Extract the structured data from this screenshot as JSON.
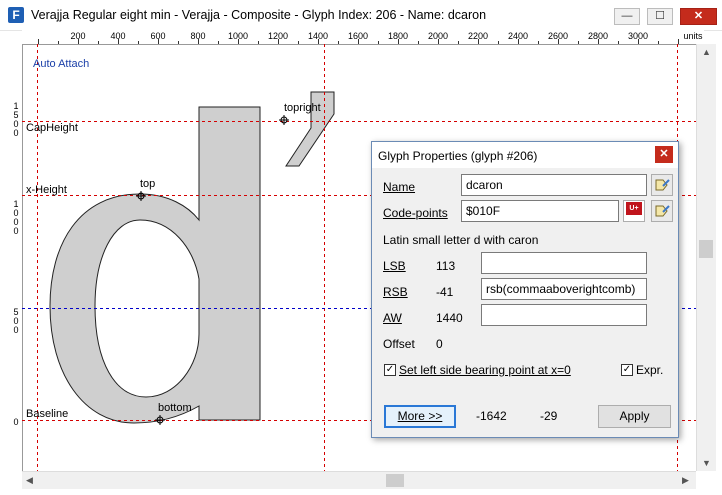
{
  "window": {
    "title": "Verajja Regular eight min - Verajja - Composite - Glyph Index: 206 - Name: dcaron",
    "app_icon": "F",
    "minimize": "—",
    "maximize": "☐",
    "close": "✕"
  },
  "ruler": {
    "top_ticks": [
      "200",
      "400",
      "600",
      "800",
      "1000",
      "1200",
      "1400",
      "1600",
      "1800",
      "2000",
      "2200",
      "2400",
      "2600",
      "2800",
      "3000"
    ],
    "units_label": "units",
    "left_labels": [
      [
        "1",
        "5",
        "0",
        "0"
      ],
      [
        "1",
        "0",
        "0",
        "0"
      ],
      [
        "5",
        "0",
        "0"
      ],
      [
        "0"
      ]
    ]
  },
  "canvas": {
    "auto_attach": "Auto Attach",
    "guides": {
      "cap_height": "CapHeight",
      "x_height": "x-Height",
      "baseline": "Baseline"
    },
    "points": {
      "top": "top",
      "topright": "topright",
      "bottom": "bottom"
    },
    "colors": {
      "red_guide": "#d40000",
      "blue_guide": "#0000c8",
      "glyph_fill": "#cfcfcf",
      "auto_attach": "#1a3fa8"
    }
  },
  "dialog": {
    "title": "Glyph Properties (glyph #206)",
    "close": "✕",
    "name_label": "Name",
    "name_value": "dcaron",
    "codepoints_label": "Code-points",
    "codepoints_value": "$010F",
    "description": "Latin small letter d with caron",
    "lsb_label": "LSB",
    "lsb_value": "113",
    "lsb_expr": "",
    "rsb_label": "RSB",
    "rsb_value": "-41",
    "rsb_expr": "rsb(commaaboverightcomb)",
    "aw_label": "AW",
    "aw_value": "1440",
    "aw_expr": "",
    "offset_label": "Offset",
    "offset_value": "0",
    "set_lsb_label": "Set left side bearing point at x=0",
    "expr_label": "Expr.",
    "more_button": "More >>",
    "coord_x": "-1642",
    "coord_y": "-29",
    "apply_button": "Apply",
    "unicode_icon_text": "U+"
  }
}
